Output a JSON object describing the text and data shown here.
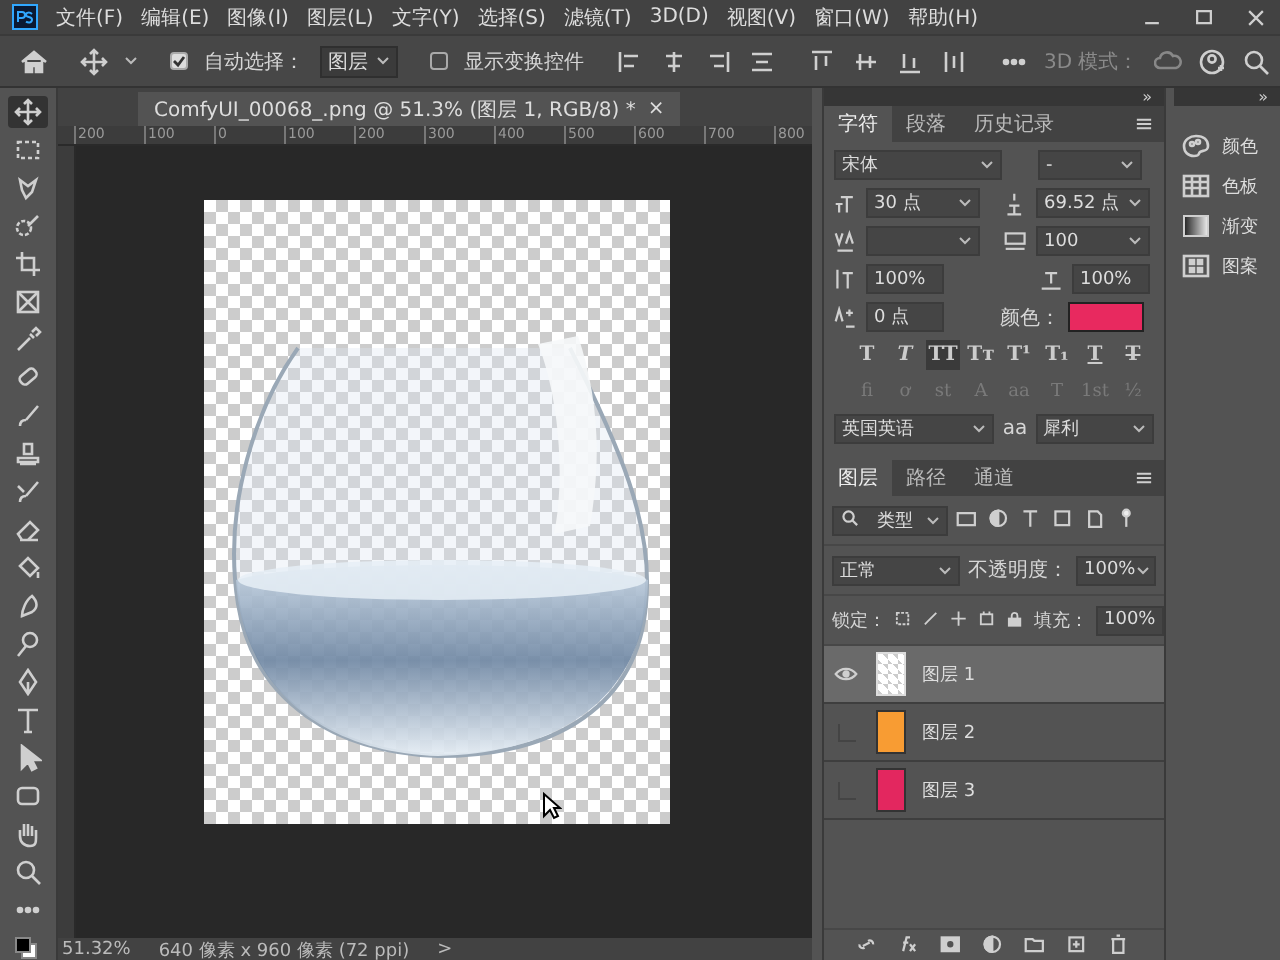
{
  "menu": [
    "文件(F)",
    "编辑(E)",
    "图像(I)",
    "图层(L)",
    "文字(Y)",
    "选择(S)",
    "滤镜(T)",
    "3D(D)",
    "视图(V)",
    "窗口(W)",
    "帮助(H)"
  ],
  "options_bar": {
    "auto_select": {
      "label": "自动选择：",
      "checked": true
    },
    "target": "图层",
    "show_transform": {
      "label": "显示变换控件",
      "checked": false
    },
    "mode_label": "3D 模式："
  },
  "document_tab": {
    "title": "ComfyUI_00068_.png @ 51.3% (图层 1, RGB/8) *",
    "close": "×"
  },
  "ruler": {
    "top_labels": [
      "200",
      "100",
      "0",
      "100",
      "200",
      "300",
      "400",
      "500",
      "600",
      "700",
      "800"
    ]
  },
  "tools": [
    {
      "kind": "move",
      "selected": true
    },
    {
      "kind": "marquee",
      "selected": false
    },
    {
      "kind": "lasso",
      "selected": false
    },
    {
      "kind": "quick-select",
      "selected": false
    },
    {
      "kind": "crop",
      "selected": false
    },
    {
      "kind": "frame",
      "selected": false
    },
    {
      "kind": "eyedropper",
      "selected": false
    },
    {
      "kind": "healing",
      "selected": false
    },
    {
      "kind": "brush",
      "selected": false
    },
    {
      "kind": "stamp",
      "selected": false
    },
    {
      "kind": "history-brush",
      "selected": false
    },
    {
      "kind": "eraser",
      "selected": false
    },
    {
      "kind": "bucket",
      "selected": false
    },
    {
      "kind": "blur",
      "selected": false
    },
    {
      "kind": "dodge",
      "selected": false
    },
    {
      "kind": "pen",
      "selected": false
    },
    {
      "kind": "type",
      "selected": false
    },
    {
      "kind": "path-select",
      "selected": false
    },
    {
      "kind": "rectangle",
      "selected": false
    },
    {
      "kind": "hand",
      "selected": false
    },
    {
      "kind": "zoom",
      "selected": false
    },
    {
      "kind": "more",
      "selected": false
    }
  ],
  "character_panel": {
    "tabs": [
      {
        "label": "字符",
        "selected": true
      },
      {
        "label": "段落",
        "selected": false
      },
      {
        "label": "历史记录",
        "selected": false
      }
    ],
    "font": "宋体",
    "style": "-",
    "size": "30 点",
    "leading": "69.52 点",
    "tracking": "100",
    "vertical_scale": "100%",
    "horizontal_scale": "100%",
    "baseline_shift": "0 点",
    "color_label": "颜色：",
    "color": "#e8295f",
    "type_styles": [
      {
        "label": "T",
        "kind": "bold",
        "selected": false
      },
      {
        "label": "T",
        "kind": "italic",
        "selected": false
      },
      {
        "label": "TT",
        "kind": "caps",
        "selected": true
      },
      {
        "label": "Tт",
        "kind": "small-caps",
        "selected": false
      },
      {
        "label": "T¹",
        "kind": "plain",
        "selected": false
      },
      {
        "label": "T₁",
        "kind": "plain",
        "selected": false
      },
      {
        "label": "T",
        "kind": "underline",
        "selected": false
      },
      {
        "label": "T",
        "kind": "strike",
        "selected": false
      }
    ],
    "opentype": [
      {
        "label": "fi",
        "disabled": true
      },
      {
        "label": "ơ",
        "disabled": true
      },
      {
        "label": "st",
        "disabled": true
      },
      {
        "label": "A",
        "disabled": true
      },
      {
        "label": "aa",
        "disabled": true
      },
      {
        "label": "T",
        "disabled": true
      },
      {
        "label": "1st",
        "disabled": true
      },
      {
        "label": "½",
        "disabled": true
      }
    ],
    "language": "英国英语",
    "antialias_label": "aa",
    "antialias": "犀利"
  },
  "layers_panel": {
    "tabs": [
      {
        "label": "图层",
        "selected": true
      },
      {
        "label": "路径",
        "selected": false
      },
      {
        "label": "通道",
        "selected": false
      }
    ],
    "filter": "类型",
    "blend_mode": "正常",
    "opacity_label": "不透明度：",
    "opacity": "100%",
    "lock_label": "锁定：",
    "fill_label": "填充：",
    "fill": "100%",
    "layers": [
      {
        "name": "图层 1",
        "kind": "image",
        "visible": true,
        "selected": true
      },
      {
        "name": "图层 2",
        "kind": "fill",
        "color": "#f89c33",
        "visible": false,
        "selected": false
      },
      {
        "name": "图层 3",
        "kind": "fill",
        "color": "#e3275f",
        "visible": false,
        "selected": false
      }
    ]
  },
  "side_panels": [
    {
      "label": "颜色",
      "kind": "color"
    },
    {
      "label": "色板",
      "kind": "swatches"
    },
    {
      "label": "渐变",
      "kind": "gradient"
    },
    {
      "label": "图案",
      "kind": "pattern"
    }
  ],
  "panel_collapse": "»",
  "side_collapse": "»",
  "status_bar": {
    "zoom": "51.32%",
    "info": "640 像素 x 960 像素 (72 ppi)",
    "arrow": ">"
  }
}
